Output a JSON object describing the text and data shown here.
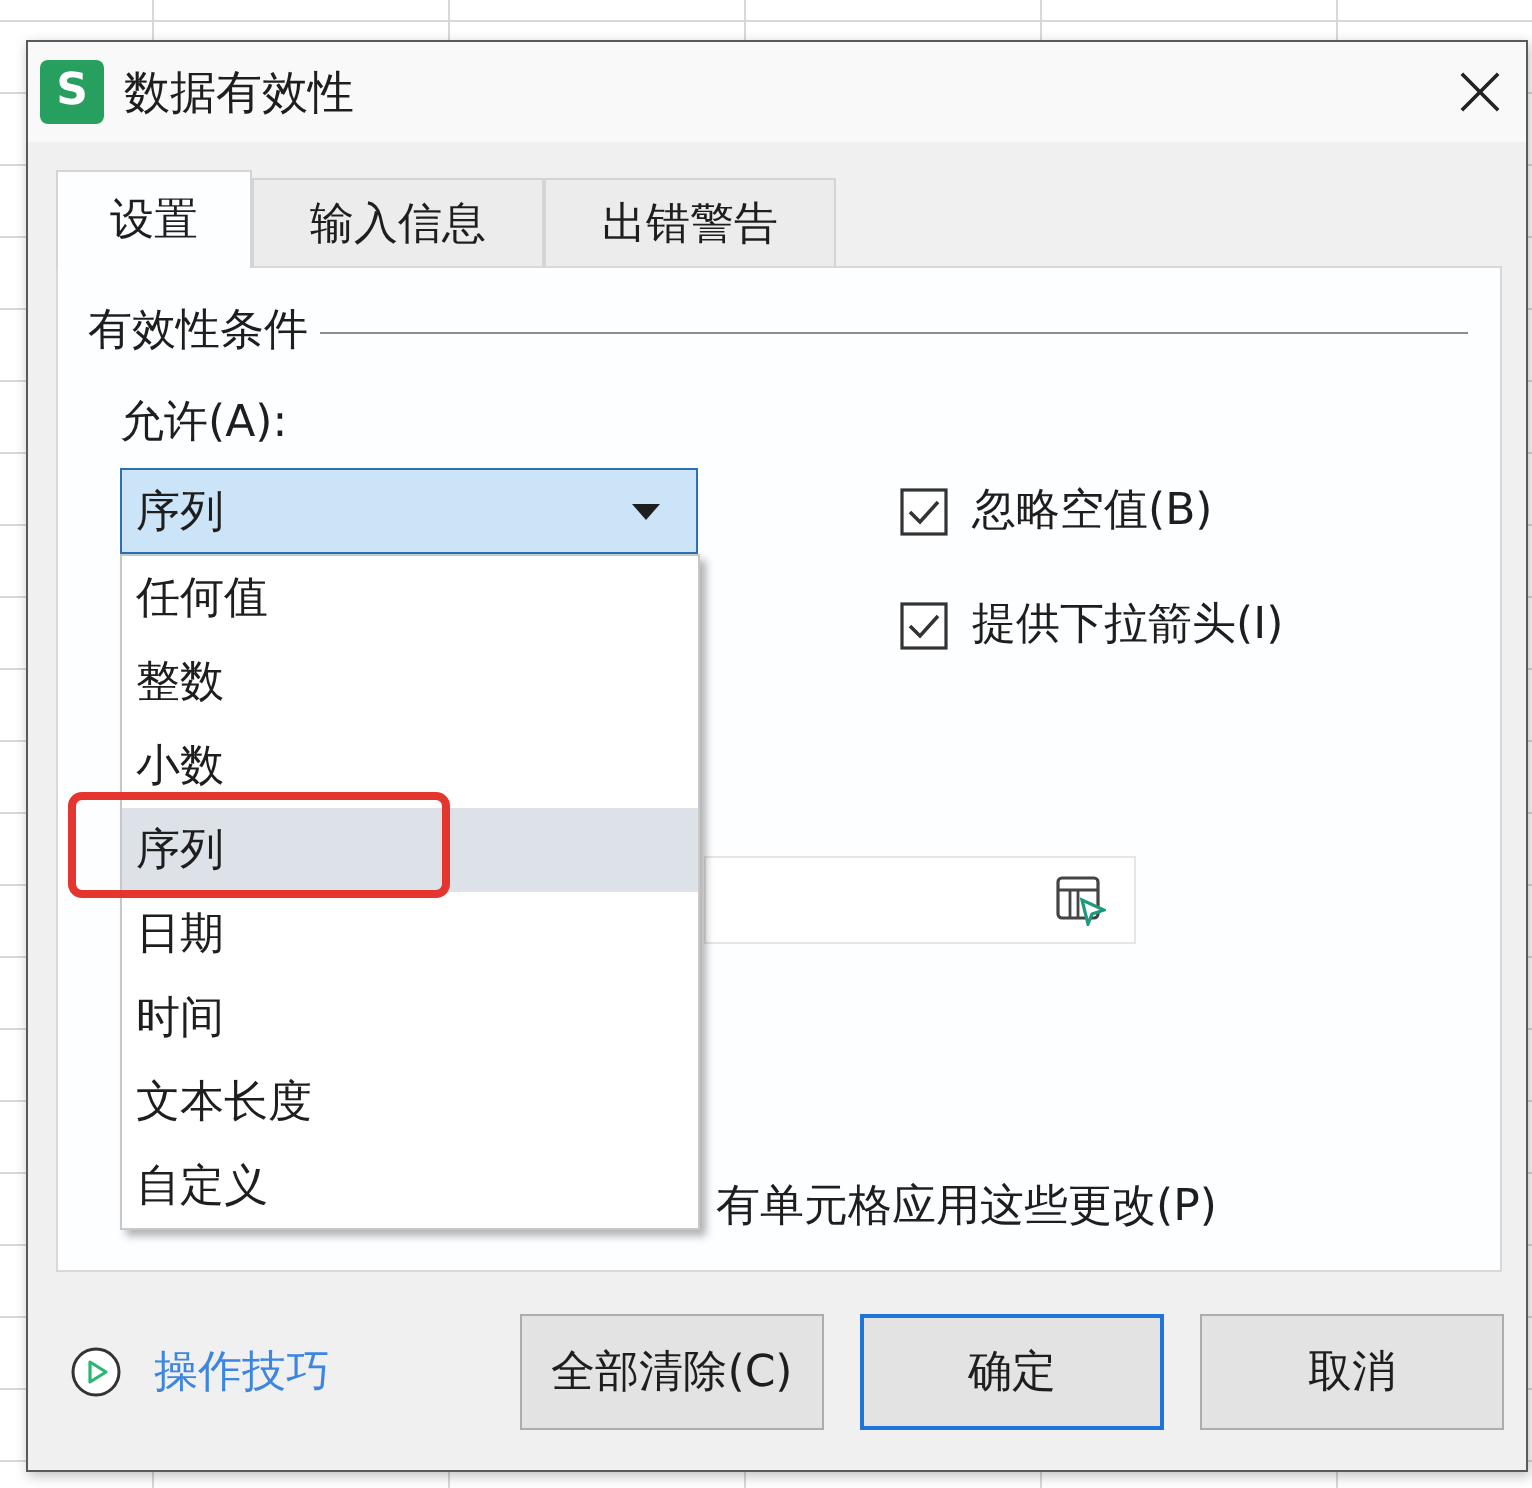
{
  "window": {
    "app_logo": "S",
    "title": "数据有效性"
  },
  "tabs": [
    {
      "label": "设置",
      "selected": true
    },
    {
      "label": "输入信息",
      "selected": false
    },
    {
      "label": "出错警告",
      "selected": false
    }
  ],
  "settings": {
    "group_label": "有效性条件",
    "allow_label": "允许(A):",
    "allow_select": {
      "value": "序列",
      "expanded": true,
      "options": [
        {
          "label": "任何值",
          "selected": false,
          "highlighted": false
        },
        {
          "label": "整数",
          "selected": false,
          "highlighted": false
        },
        {
          "label": "小数",
          "selected": false,
          "highlighted": false
        },
        {
          "label": "序列",
          "selected": true,
          "highlighted": true
        },
        {
          "label": "日期",
          "selected": false,
          "highlighted": false
        },
        {
          "label": "时间",
          "selected": false,
          "highlighted": false
        },
        {
          "label": "文本长度",
          "selected": false,
          "highlighted": false
        },
        {
          "label": "自定义",
          "selected": false,
          "highlighted": false
        }
      ]
    },
    "checkboxes": [
      {
        "label": "忽略空值(B)",
        "checked": true
      },
      {
        "label": "提供下拉箭头(I)",
        "checked": true
      }
    ],
    "apply_label": "有单元格应用这些更改(P)"
  },
  "footer": {
    "tips_link": "操作技巧",
    "buttons": [
      {
        "label": "全部清除(C)",
        "default": false
      },
      {
        "label": "确定",
        "default": true
      },
      {
        "label": "取消",
        "default": false
      }
    ]
  }
}
